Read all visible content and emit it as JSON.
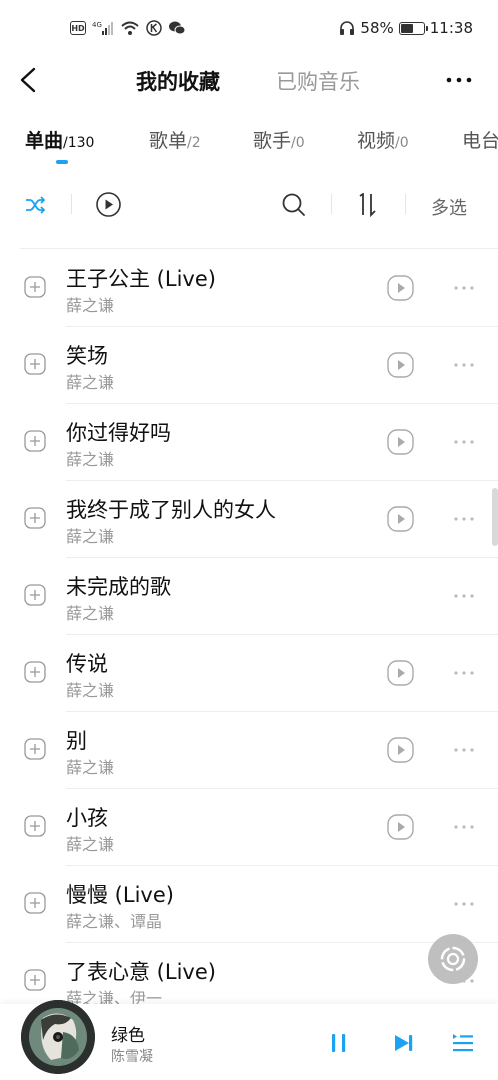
{
  "status_bar": {
    "hd": "HD",
    "network": "4G",
    "battery_percent": 58,
    "battery_text": "58%",
    "time": "11:38"
  },
  "header": {
    "title": "我的收藏",
    "secondary_tab": "已购音乐"
  },
  "tabs": [
    {
      "label": "单曲",
      "count": "/130",
      "active": true
    },
    {
      "label": "歌单",
      "count": "/2",
      "active": false
    },
    {
      "label": "歌手",
      "count": "/0",
      "active": false
    },
    {
      "label": "视频",
      "count": "/0",
      "active": false
    },
    {
      "label": "电台",
      "count": "",
      "active": false
    }
  ],
  "toolbar": {
    "multi_select": "多选",
    "accent_color": "#1da1f2"
  },
  "songs": [
    {
      "title": "王子公主 (Live)",
      "artist": "薛之谦",
      "has_mv": true
    },
    {
      "title": "笑场",
      "artist": "薛之谦",
      "has_mv": true
    },
    {
      "title": "你过得好吗",
      "artist": "薛之谦",
      "has_mv": true
    },
    {
      "title": "我终于成了别人的女人",
      "artist": "薛之谦",
      "has_mv": true
    },
    {
      "title": "未完成的歌",
      "artist": "薛之谦",
      "has_mv": false
    },
    {
      "title": "传说",
      "artist": "薛之谦",
      "has_mv": true
    },
    {
      "title": "别",
      "artist": "薛之谦",
      "has_mv": true
    },
    {
      "title": "小孩",
      "artist": "薛之谦",
      "has_mv": true
    },
    {
      "title": "慢慢 (Live)",
      "artist": "薛之谦、谭晶",
      "has_mv": false
    },
    {
      "title": "了表心意 (Live)",
      "artist": "薛之谦、伊一",
      "has_mv": false
    }
  ],
  "now_playing": {
    "title": "绿色",
    "artist": "陈雪凝"
  },
  "icons": {
    "back": "back-arrow-icon",
    "more": "more-icon",
    "shuffle": "shuffle-icon",
    "play_all": "play-circle-icon",
    "search": "search-icon",
    "sort": "sort-icon",
    "add": "add-icon",
    "mv": "mv-play-icon",
    "pause": "pause-icon",
    "next": "next-icon",
    "playlist": "playlist-icon",
    "float": "float-recognize-icon"
  }
}
